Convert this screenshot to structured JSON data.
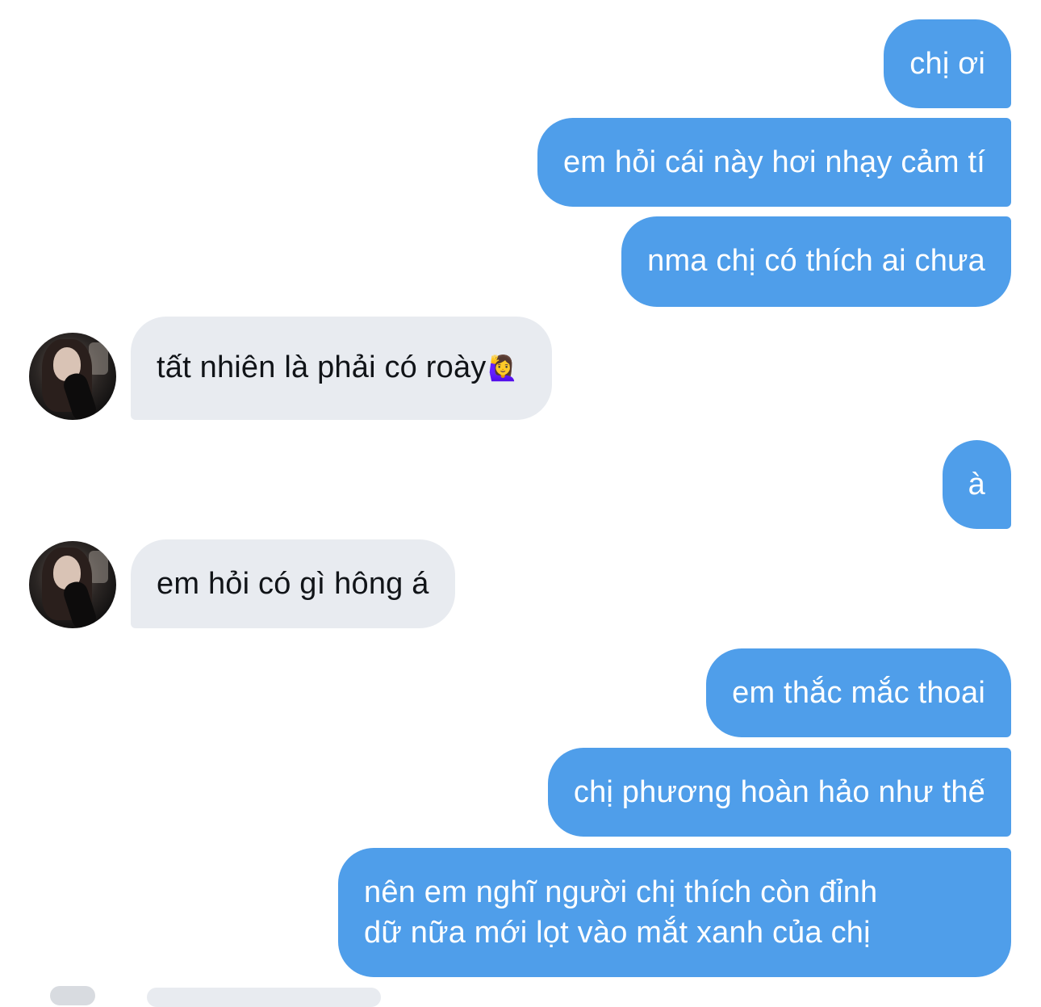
{
  "messages": [
    {
      "side": "out",
      "text": "chị ơi"
    },
    {
      "side": "out",
      "text": "em hỏi cái này hơi nhạy cảm tí"
    },
    {
      "side": "out",
      "text": "nma chị có thích ai chưa"
    },
    {
      "side": "in",
      "text": "tất nhiên là phải có roày",
      "emoji": "🙋‍♀️"
    },
    {
      "side": "out",
      "text": "à"
    },
    {
      "side": "in",
      "text": "em hỏi có gì hông á"
    },
    {
      "side": "out",
      "text": "em thắc mắc thoai"
    },
    {
      "side": "out",
      "text": "chị phương hoàn hảo như thế"
    },
    {
      "side": "out",
      "line1": "nên em nghĩ người chị thích còn đỉnh",
      "line2": "dữ nữa mới lọt vào mắt xanh của chị"
    }
  ],
  "colors": {
    "outgoing_bubble": "#4f9eea",
    "incoming_bubble": "#e8ebf0",
    "background": "#ffffff"
  },
  "icons": {
    "avatar": "contact-avatar-photo"
  }
}
